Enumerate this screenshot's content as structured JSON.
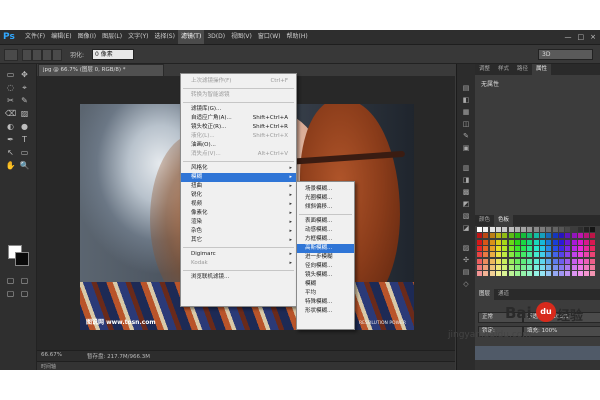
{
  "app": {
    "logo": "Ps",
    "menus": [
      "文件(F)",
      "编辑(E)",
      "图像(I)",
      "图层(L)",
      "文字(Y)",
      "选择(S)",
      "滤镜(T)",
      "3D(D)",
      "视图(V)",
      "窗口(W)",
      "帮助(H)"
    ],
    "active_menu_index": 6,
    "window_buttons": [
      "—",
      "□",
      "×"
    ]
  },
  "options_bar": {
    "feather_label": "羽化:",
    "feather_value": "0 像素",
    "workspace_value": "3D"
  },
  "document": {
    "tab_title": "jpg @ 66.7% (图层 0, RGB/8) *",
    "status_zoom": "66.67%",
    "status_doc": "暂存盘: 217.7M/966.3M",
    "timeline_label": "时间轴",
    "watermark_left": "图说网 www.tosn.com",
    "watermark_right": "RESOLUTION POWER"
  },
  "filter_menu": {
    "items": [
      {
        "label": "上次滤镜操作(F)",
        "shortcut": "Ctrl+F",
        "disabled": true
      },
      {
        "sep": true
      },
      {
        "label": "转换为智能滤镜",
        "shortcut": "",
        "disabled": true
      },
      {
        "sep": true
      },
      {
        "label": "滤镜库(G)...",
        "shortcut": ""
      },
      {
        "label": "自适应广角(A)...",
        "shortcut": "Shift+Ctrl+A"
      },
      {
        "label": "镜头校正(R)...",
        "shortcut": "Shift+Ctrl+R"
      },
      {
        "label": "液化(L)...",
        "shortcut": "Shift+Ctrl+X",
        "disabled": true
      },
      {
        "label": "油画(O)...",
        "shortcut": ""
      },
      {
        "label": "消失点(V)...",
        "shortcut": "Alt+Ctrl+V",
        "disabled": true
      },
      {
        "sep": true
      },
      {
        "label": "风格化",
        "submenu": true
      },
      {
        "label": "模糊",
        "submenu": true,
        "highlighted": true
      },
      {
        "label": "扭曲",
        "submenu": true
      },
      {
        "label": "锐化",
        "submenu": true
      },
      {
        "label": "视频",
        "submenu": true
      },
      {
        "label": "像素化",
        "submenu": true
      },
      {
        "label": "渲染",
        "submenu": true
      },
      {
        "label": "杂色",
        "submenu": true
      },
      {
        "label": "其它",
        "submenu": true
      },
      {
        "sep": true
      },
      {
        "label": "Digimarc",
        "submenu": true
      },
      {
        "label": "Kodak",
        "submenu": true,
        "disabled": true
      },
      {
        "sep": true
      },
      {
        "label": "浏览联机滤镜...",
        "shortcut": ""
      }
    ]
  },
  "blur_submenu": {
    "items": [
      {
        "label": "场景模糊..."
      },
      {
        "label": "光圈模糊..."
      },
      {
        "label": "倾斜偏移..."
      },
      {
        "sep": true
      },
      {
        "label": "表面模糊..."
      },
      {
        "label": "动感模糊..."
      },
      {
        "label": "方框模糊..."
      },
      {
        "label": "高斯模糊...",
        "highlighted": true
      },
      {
        "label": "进一步模糊"
      },
      {
        "label": "径向模糊..."
      },
      {
        "label": "镜头模糊..."
      },
      {
        "label": "模糊"
      },
      {
        "label": "平均"
      },
      {
        "label": "特殊模糊..."
      },
      {
        "label": "形状模糊..."
      }
    ]
  },
  "panels": {
    "top_tabs": [
      "调整",
      "样式",
      "路径",
      "属性"
    ],
    "active_top_tab": 3,
    "properties_title": "无属性",
    "mid_tabs": [
      "颜色",
      "色板"
    ],
    "active_mid_tab": 1,
    "layer_tabs": [
      "图层",
      "通道"
    ],
    "blend_mode": "正常",
    "opacity_label": "不透明度:",
    "opacity_value": "100%",
    "fill_label": "填充:",
    "fill_value": "100%",
    "lock_label": "锁定:"
  },
  "colors": {
    "menu_highlight": "#2f75d6",
    "ps_blue": "#31a8ff",
    "baidu_red": "#d72a1c"
  },
  "branding": {
    "logo_bai": "Bai",
    "logo_paw": "du",
    "logo_jy": "经验",
    "url": "jingyan.baidu.com"
  }
}
